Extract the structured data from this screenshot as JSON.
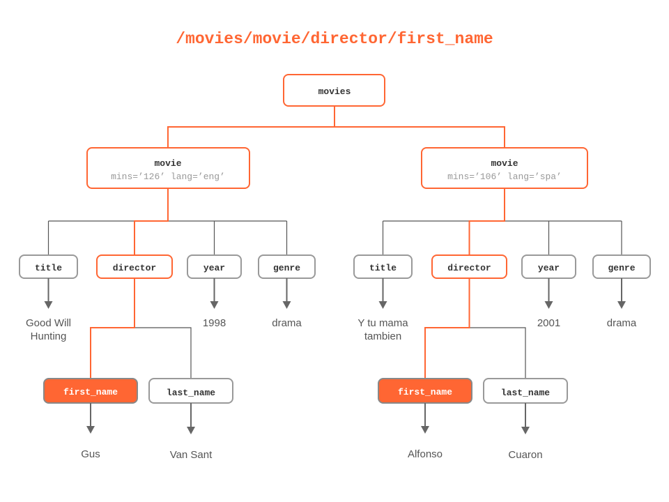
{
  "title": "/movies/movie/director/first_name",
  "colors": {
    "accent": "#FF6633",
    "gray_border": "#999999",
    "line": "#555555",
    "text": "#333333",
    "attr_text": "#999999",
    "value_text": "#555555"
  },
  "root": {
    "label": "movies"
  },
  "movies": [
    {
      "label": "movie",
      "attrs": "mins=’126’ lang=’eng’",
      "children": [
        {
          "label": "title",
          "value": [
            "Good Will",
            "Hunting"
          ]
        },
        {
          "label": "director"
        },
        {
          "label": "year",
          "value": [
            "1998"
          ]
        },
        {
          "label": "genre",
          "value": [
            "drama"
          ]
        }
      ],
      "director": {
        "first_name": {
          "label": "first_name",
          "value": "Gus"
        },
        "last_name": {
          "label": "last_name",
          "value": "Van Sant"
        }
      }
    },
    {
      "label": "movie",
      "attrs": "mins=’106’ lang=’spa’",
      "children": [
        {
          "label": "title",
          "value": [
            "Y tu mama",
            "tambien"
          ]
        },
        {
          "label": "director"
        },
        {
          "label": "year",
          "value": [
            "2001"
          ]
        },
        {
          "label": "genre",
          "value": [
            "drama"
          ]
        }
      ],
      "director": {
        "first_name": {
          "label": "first_name",
          "value": "Alfonso"
        },
        "last_name": {
          "label": "last_name",
          "value": "Cuaron"
        }
      }
    }
  ]
}
